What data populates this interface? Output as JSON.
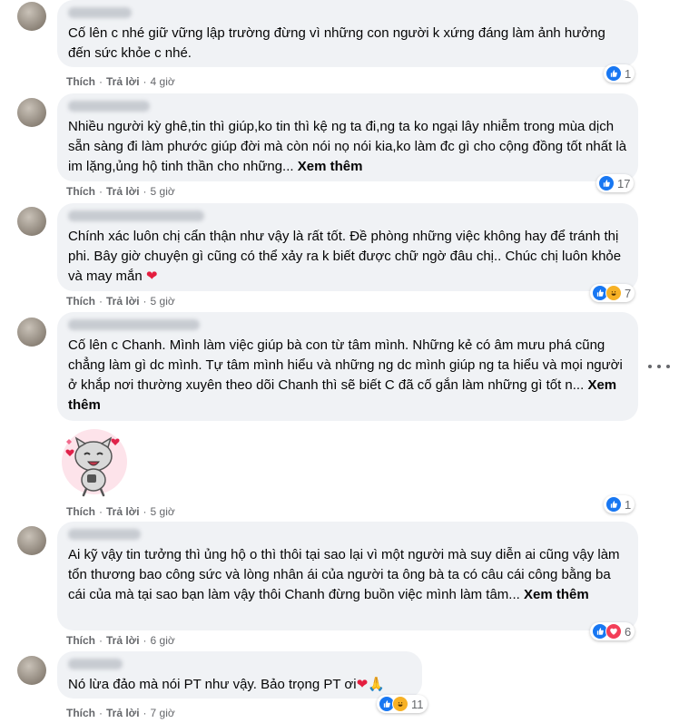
{
  "comments": [
    {
      "text": "Cố lên c nhé giữ vững lập trường đừng vì những con người k xứng đáng làm ảnh hưởng đến sức khỏe c nhé.",
      "more": "",
      "like": "Thích",
      "reply": "Trả lời",
      "time": "4 giờ",
      "reactions": "1"
    },
    {
      "text": "Nhiều người kỳ ghê,tin thì giúp,ko tin thì kệ ng ta đi,ng ta ko ngại lây nhiễm trong mùa dịch sẵn sàng đi làm phước giúp đời mà còn nói nọ nói kia,ko làm đc gì cho cộng đồng tốt nhất là im lặng,ủng hộ tinh thần cho những...",
      "more": "Xem thêm",
      "like": "Thích",
      "reply": "Trả lời",
      "time": "5 giờ",
      "reactions": "17"
    },
    {
      "text": "Chính xác luôn chị cẩn thận như vậy là rất tốt. Đề phòng những việc không hay để tránh thị phi. Bây giờ chuyện gì cũng có thể xảy ra k biết được chữ ngờ đâu chị.. Chúc chị luôn khỏe và may mắn",
      "more": "",
      "like": "Thích",
      "reply": "Trả lời",
      "time": "5 giờ",
      "reactions": "7"
    },
    {
      "text": "Cố lên c Chanh. Mình làm việc giúp bà con từ tâm mình. Những kẻ có âm mưu phá cũng chẳng làm gì dc mình. Tự tâm mình hiểu và những ng dc mình giúp ng ta hiểu và mọi người ở khắp nơi thường xuyên theo dõi Chanh thì sẽ biết C đã cố gắn làm những gì tốt n...",
      "more": "Xem thêm",
      "like": "Thích",
      "reply": "Trả lời",
      "time": "5 giờ",
      "reactions": "1"
    },
    {
      "text": "Ai kỹ vậy tin tưởng thì ủng hộ o thì thôi tại sao lại vì một người mà suy diễn ai cũng vậy làm tổn thương bao công sức và lòng nhân ái của người ta ông bà ta có câu cái công bằng ba cái của mà tại sao bạn làm vậy thôi Chanh đừng buồn việc mình làm tâm...",
      "more": "Xem thêm",
      "like": "Thích",
      "reply": "Trả lời",
      "time": "6 giờ",
      "reactions": "6"
    },
    {
      "text": "Nó lừa đảo mà nói PT như vậy. Bảo trọng PT ơi",
      "more": "",
      "like": "Thích",
      "reply": "Trả lời",
      "time": "7 giờ",
      "reactions": "11"
    }
  ],
  "icons": {
    "like": "like-icon",
    "heart": "heart-icon",
    "haha": "haha-icon",
    "sticker": "cat-sticker",
    "more": "more-options-icon"
  },
  "colors": {
    "like": "#1877f2",
    "heart": "#f33e58",
    "haha": "#f7b125",
    "bubble": "#f0f2f5",
    "meta": "#65676b"
  }
}
